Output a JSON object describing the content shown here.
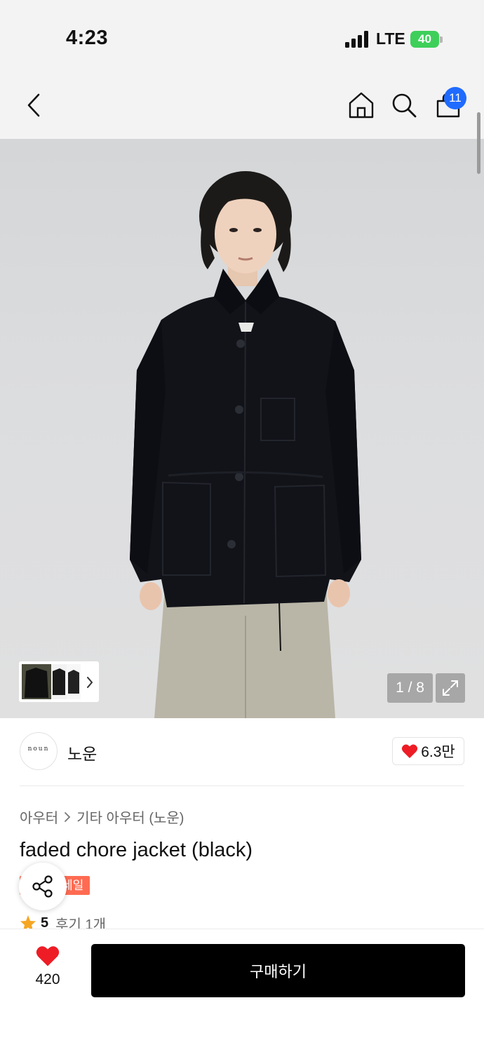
{
  "status_bar": {
    "time": "4:23",
    "network": "LTE",
    "battery": "40"
  },
  "nav": {
    "cart_count": "11",
    "icons": [
      "back-chevron-icon",
      "home-icon",
      "search-icon",
      "shopping-bag-icon"
    ]
  },
  "gallery": {
    "counter": "1 / 8",
    "current_index": 1,
    "total": 8
  },
  "brand": {
    "logo_text": "noun",
    "name": "노운",
    "like_count": "6.3만"
  },
  "product": {
    "breadcrumb": [
      "아우터",
      "기타 아우터 (노운)"
    ],
    "title": "faded chore jacket (black)",
    "sale_badge": "세일",
    "rating": "5",
    "review_label": "후기 1개"
  },
  "bottom_bar": {
    "wish_count": "420",
    "buy_label": "구매하기"
  },
  "colors": {
    "sale": "#ff6b52",
    "badge_blue": "#1f6bff",
    "heart_red": "#ee1c25",
    "battery_green": "#3ecf5a",
    "star": "#f5a623"
  }
}
